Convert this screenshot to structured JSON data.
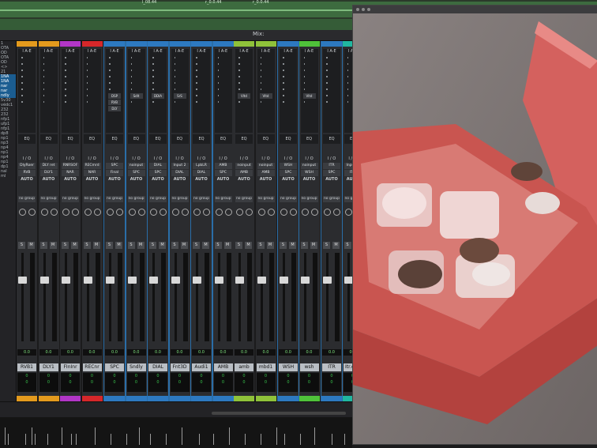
{
  "edit_window": {
    "clip_labels": [
      "l_08.44",
      "r_0.0.44",
      "r_0.0.44"
    ]
  },
  "mix_window": {
    "title": "Mix:",
    "left_panel": {
      "items": [
        "1",
        "OTA",
        "OD",
        "OTA",
        "OD",
        "<>",
        "21",
        "1NA",
        "1NA",
        "nar",
        "nar",
        "ndly",
        "5v30",
        "védc1",
        "232",
        "232",
        "nfp1",
        "ufp1",
        "nfp1",
        "dp8",
        "np1",
        "np3",
        "np4",
        "np1",
        "np4",
        "np1",
        "dp1",
        "nal",
        "ml"
      ]
    },
    "strips": [
      {
        "name": "RVB1",
        "io_in": "DlyRoer",
        "io_out": "RVB",
        "color": "#e39a1d",
        "plugins": [],
        "counter": [
          "0",
          "0"
        ]
      },
      {
        "name": "DLY1",
        "io_in": "DLY ret",
        "io_out": "DLY1",
        "color": "#e39a1d",
        "plugins": [],
        "counter": [
          "0",
          "0"
        ]
      },
      {
        "name": "FInInr",
        "io_in": "RNRSOF",
        "io_out": "NAR",
        "color": "#b236c7",
        "plugins": [],
        "counter": [
          "0",
          "0"
        ]
      },
      {
        "name": "RECnr",
        "io_in": "RECmrd",
        "io_out": "NAR",
        "color": "#d6272a",
        "plugins": [],
        "counter": [
          "0",
          "0"
        ]
      },
      {
        "name": "SPC",
        "io_in": "SPC",
        "io_out": "Final",
        "color": "#2d79c0",
        "plugins": [
          "DSP",
          "RVB",
          "DLY"
        ],
        "counter": [
          "0",
          "0"
        ]
      },
      {
        "name": "Sndly",
        "io_in": "noinput",
        "io_out": "SPC",
        "color": "#2d79c0",
        "plugins": [
          "Sdlt"
        ],
        "counter": [
          "0",
          "0"
        ]
      },
      {
        "name": "DIAL",
        "io_in": "DIAL",
        "io_out": "SPC",
        "color": "#2d79c0",
        "plugins": [
          "DDIA"
        ],
        "counter": [
          "0",
          "0"
        ]
      },
      {
        "name": "Fnt3D",
        "io_in": "Input 2",
        "io_out": "DIAL",
        "color": "#2d79c0",
        "plugins": [
          "SrS"
        ],
        "counter": [
          "0",
          "0"
        ]
      },
      {
        "name": "Audi1",
        "io_in": "LpbLR",
        "io_out": "DIAL",
        "color": "#2d79c0",
        "plugins": [],
        "counter": [
          "0",
          "0"
        ]
      },
      {
        "name": "AMB",
        "io_in": "AMB",
        "io_out": "SPC",
        "color": "#2d79c0",
        "plugins": [],
        "counter": [
          "0",
          "0"
        ]
      },
      {
        "name": "amb",
        "io_in": "noinput",
        "io_out": "AMB",
        "color": "#8fc23a",
        "plugins": [
          "Vltd"
        ],
        "counter": [
          "0",
          "0"
        ]
      },
      {
        "name": "mbd1",
        "io_in": "noinput",
        "io_out": "AMB",
        "color": "#8fc23a",
        "plugins": [
          "Vltd"
        ],
        "counter": [
          "0",
          "0"
        ]
      },
      {
        "name": "WSH",
        "io_in": "WSH",
        "io_out": "SPC",
        "color": "#2d79c0",
        "plugins": [],
        "counter": [
          "0",
          "0"
        ]
      },
      {
        "name": "wsh",
        "io_in": "noinput",
        "io_out": "WSH",
        "color": "#4fc23a",
        "plugins": [
          "Vltd"
        ],
        "counter": [
          "0",
          "0"
        ]
      },
      {
        "name": "ITR",
        "io_in": "ITR",
        "io_out": "SPC",
        "color": "#2d79c0",
        "plugins": [],
        "counter": [
          "0",
          "0"
        ]
      },
      {
        "name": "Itr.dpll",
        "io_in": "Input 1",
        "io_out": "ITR",
        "color": "#20b7a0",
        "plugins": [],
        "counter": [
          "0",
          "0"
        ]
      }
    ],
    "labels": {
      "insert_header": "I A-E",
      "eq": "EQ",
      "io": "I / O",
      "auto": "AUTO",
      "group": "no group",
      "solo": "S",
      "mute": "M",
      "vol": "0.0"
    }
  },
  "viewer": {
    "photo_icon": "chocolate-box-photo"
  }
}
